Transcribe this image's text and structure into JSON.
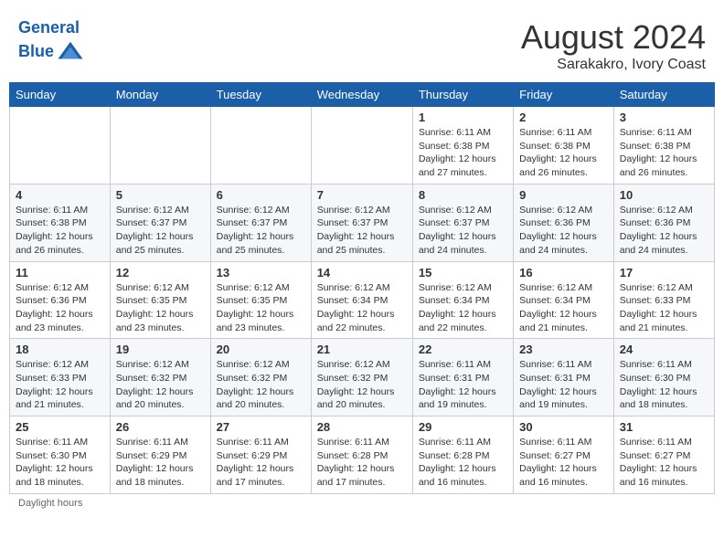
{
  "header": {
    "logo_line1": "General",
    "logo_line2": "Blue",
    "month_year": "August 2024",
    "location": "Sarakakro, Ivory Coast"
  },
  "days_of_week": [
    "Sunday",
    "Monday",
    "Tuesday",
    "Wednesday",
    "Thursday",
    "Friday",
    "Saturday"
  ],
  "weeks": [
    [
      {
        "day": "",
        "info": ""
      },
      {
        "day": "",
        "info": ""
      },
      {
        "day": "",
        "info": ""
      },
      {
        "day": "",
        "info": ""
      },
      {
        "day": "1",
        "info": "Sunrise: 6:11 AM\nSunset: 6:38 PM\nDaylight: 12 hours and 27 minutes."
      },
      {
        "day": "2",
        "info": "Sunrise: 6:11 AM\nSunset: 6:38 PM\nDaylight: 12 hours and 26 minutes."
      },
      {
        "day": "3",
        "info": "Sunrise: 6:11 AM\nSunset: 6:38 PM\nDaylight: 12 hours and 26 minutes."
      }
    ],
    [
      {
        "day": "4",
        "info": "Sunrise: 6:11 AM\nSunset: 6:38 PM\nDaylight: 12 hours and 26 minutes."
      },
      {
        "day": "5",
        "info": "Sunrise: 6:12 AM\nSunset: 6:37 PM\nDaylight: 12 hours and 25 minutes."
      },
      {
        "day": "6",
        "info": "Sunrise: 6:12 AM\nSunset: 6:37 PM\nDaylight: 12 hours and 25 minutes."
      },
      {
        "day": "7",
        "info": "Sunrise: 6:12 AM\nSunset: 6:37 PM\nDaylight: 12 hours and 25 minutes."
      },
      {
        "day": "8",
        "info": "Sunrise: 6:12 AM\nSunset: 6:37 PM\nDaylight: 12 hours and 24 minutes."
      },
      {
        "day": "9",
        "info": "Sunrise: 6:12 AM\nSunset: 6:36 PM\nDaylight: 12 hours and 24 minutes."
      },
      {
        "day": "10",
        "info": "Sunrise: 6:12 AM\nSunset: 6:36 PM\nDaylight: 12 hours and 24 minutes."
      }
    ],
    [
      {
        "day": "11",
        "info": "Sunrise: 6:12 AM\nSunset: 6:36 PM\nDaylight: 12 hours and 23 minutes."
      },
      {
        "day": "12",
        "info": "Sunrise: 6:12 AM\nSunset: 6:35 PM\nDaylight: 12 hours and 23 minutes."
      },
      {
        "day": "13",
        "info": "Sunrise: 6:12 AM\nSunset: 6:35 PM\nDaylight: 12 hours and 23 minutes."
      },
      {
        "day": "14",
        "info": "Sunrise: 6:12 AM\nSunset: 6:34 PM\nDaylight: 12 hours and 22 minutes."
      },
      {
        "day": "15",
        "info": "Sunrise: 6:12 AM\nSunset: 6:34 PM\nDaylight: 12 hours and 22 minutes."
      },
      {
        "day": "16",
        "info": "Sunrise: 6:12 AM\nSunset: 6:34 PM\nDaylight: 12 hours and 21 minutes."
      },
      {
        "day": "17",
        "info": "Sunrise: 6:12 AM\nSunset: 6:33 PM\nDaylight: 12 hours and 21 minutes."
      }
    ],
    [
      {
        "day": "18",
        "info": "Sunrise: 6:12 AM\nSunset: 6:33 PM\nDaylight: 12 hours and 21 minutes."
      },
      {
        "day": "19",
        "info": "Sunrise: 6:12 AM\nSunset: 6:32 PM\nDaylight: 12 hours and 20 minutes."
      },
      {
        "day": "20",
        "info": "Sunrise: 6:12 AM\nSunset: 6:32 PM\nDaylight: 12 hours and 20 minutes."
      },
      {
        "day": "21",
        "info": "Sunrise: 6:12 AM\nSunset: 6:32 PM\nDaylight: 12 hours and 20 minutes."
      },
      {
        "day": "22",
        "info": "Sunrise: 6:11 AM\nSunset: 6:31 PM\nDaylight: 12 hours and 19 minutes."
      },
      {
        "day": "23",
        "info": "Sunrise: 6:11 AM\nSunset: 6:31 PM\nDaylight: 12 hours and 19 minutes."
      },
      {
        "day": "24",
        "info": "Sunrise: 6:11 AM\nSunset: 6:30 PM\nDaylight: 12 hours and 18 minutes."
      }
    ],
    [
      {
        "day": "25",
        "info": "Sunrise: 6:11 AM\nSunset: 6:30 PM\nDaylight: 12 hours and 18 minutes."
      },
      {
        "day": "26",
        "info": "Sunrise: 6:11 AM\nSunset: 6:29 PM\nDaylight: 12 hours and 18 minutes."
      },
      {
        "day": "27",
        "info": "Sunrise: 6:11 AM\nSunset: 6:29 PM\nDaylight: 12 hours and 17 minutes."
      },
      {
        "day": "28",
        "info": "Sunrise: 6:11 AM\nSunset: 6:28 PM\nDaylight: 12 hours and 17 minutes."
      },
      {
        "day": "29",
        "info": "Sunrise: 6:11 AM\nSunset: 6:28 PM\nDaylight: 12 hours and 16 minutes."
      },
      {
        "day": "30",
        "info": "Sunrise: 6:11 AM\nSunset: 6:27 PM\nDaylight: 12 hours and 16 minutes."
      },
      {
        "day": "31",
        "info": "Sunrise: 6:11 AM\nSunset: 6:27 PM\nDaylight: 12 hours and 16 minutes."
      }
    ]
  ],
  "footer": {
    "daylight_label": "Daylight hours"
  }
}
